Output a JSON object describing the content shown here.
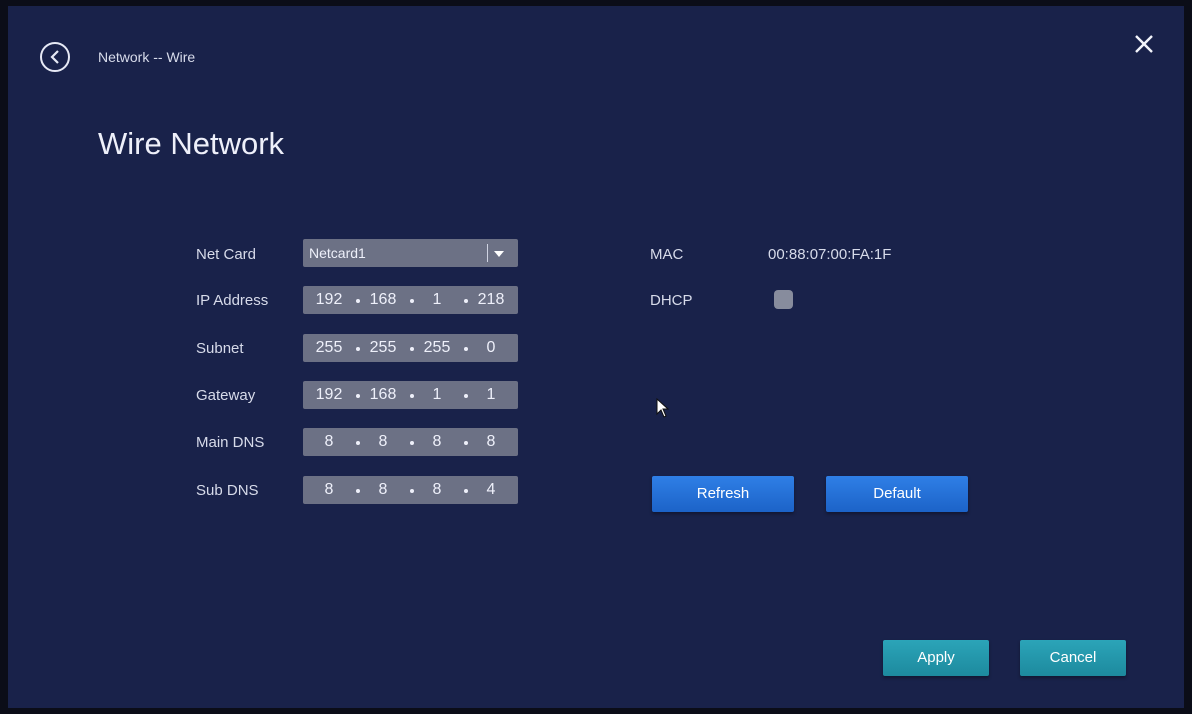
{
  "header": {
    "breadcrumb": "Network -- Wire",
    "title": "Wire Network"
  },
  "fields": {
    "net_card": {
      "label": "Net Card",
      "value": "Netcard1"
    },
    "ip_address": {
      "label": "IP Address",
      "octets": [
        "192",
        "168",
        "1",
        "218"
      ]
    },
    "subnet": {
      "label": "Subnet",
      "octets": [
        "255",
        "255",
        "255",
        "0"
      ]
    },
    "gateway": {
      "label": "Gateway",
      "octets": [
        "192",
        "168",
        "1",
        "1"
      ]
    },
    "main_dns": {
      "label": "Main DNS",
      "octets": [
        "8",
        "8",
        "8",
        "8"
      ]
    },
    "sub_dns": {
      "label": "Sub DNS",
      "octets": [
        "8",
        "8",
        "8",
        "4"
      ]
    }
  },
  "info": {
    "mac_label": "MAC",
    "mac_value": "00:88:07:00:FA:1F",
    "dhcp_label": "DHCP",
    "dhcp_checked": false
  },
  "buttons": {
    "refresh": "Refresh",
    "default": "Default",
    "apply": "Apply",
    "cancel": "Cancel"
  },
  "icons": {
    "back": "back-circle-icon",
    "close": "close-icon",
    "dropdown": "chevron-down-icon",
    "pointer": "mouse-pointer-icon"
  },
  "colors": {
    "background": "#19224a",
    "field": "#6c7185",
    "action_blue": "#2f7fe6",
    "action_teal": "#2ba4b8"
  }
}
